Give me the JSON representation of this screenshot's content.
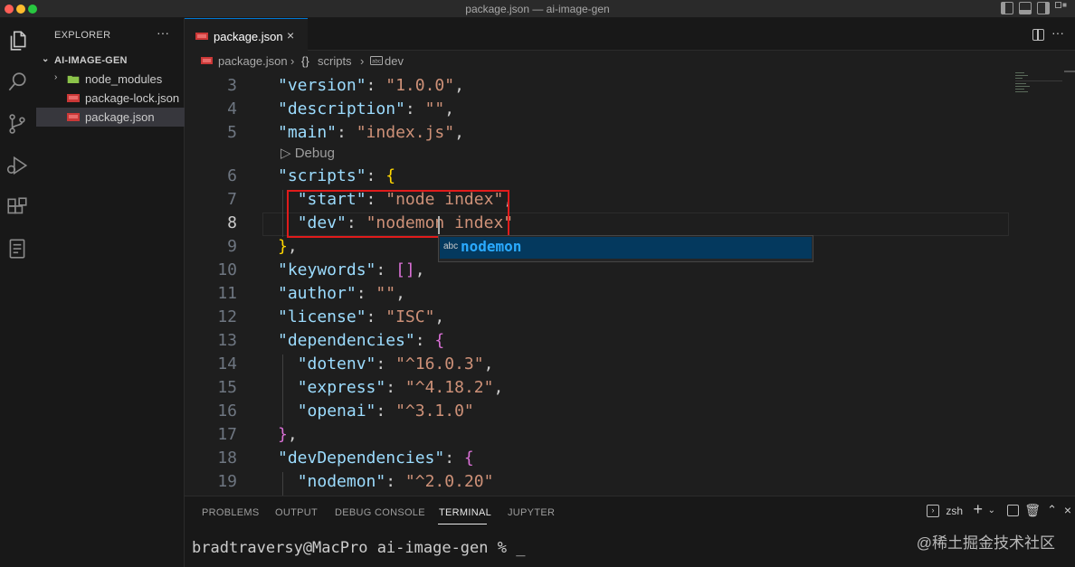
{
  "window": {
    "title": "package.json — ai-image-gen"
  },
  "activity_bar": {
    "icons": [
      "files-icon",
      "search-icon",
      "source-control-icon",
      "run-debug-icon",
      "extensions-icon",
      "notebook-icon"
    ]
  },
  "sidebar": {
    "title": "EXPLORER",
    "more": "···",
    "folder": "AI-IMAGE-GEN",
    "items": [
      {
        "name": "node_modules",
        "type": "folder",
        "selected": false
      },
      {
        "name": "package-lock.json",
        "type": "json",
        "selected": false
      },
      {
        "name": "package.json",
        "type": "json",
        "selected": true
      }
    ]
  },
  "tabs": [
    {
      "label": "package.json",
      "close": "×"
    }
  ],
  "tab_more": "···",
  "breadcrumb": {
    "file": "package.json",
    "section_icon": "{}",
    "section": "scripts",
    "leaf": "dev",
    "sep": "›"
  },
  "editor": {
    "debug_lens": "▷ Debug",
    "active_line": 8,
    "lines": [
      {
        "n": "3",
        "tokens": [
          [
            "k",
            "\"version\""
          ],
          [
            "p",
            ": "
          ],
          [
            "s",
            "\"1.0.0\""
          ],
          [
            "p",
            ","
          ]
        ]
      },
      {
        "n": "4",
        "tokens": [
          [
            "k",
            "\"description\""
          ],
          [
            "p",
            ": "
          ],
          [
            "s",
            "\"\""
          ],
          [
            "p",
            ","
          ]
        ]
      },
      {
        "n": "5",
        "tokens": [
          [
            "k",
            "\"main\""
          ],
          [
            "p",
            ": "
          ],
          [
            "s",
            "\"index.js\""
          ],
          [
            "p",
            ","
          ]
        ]
      },
      {
        "n": "6",
        "tokens": [
          [
            "k",
            "\"scripts\""
          ],
          [
            "p",
            ": "
          ],
          [
            "b2",
            "{"
          ]
        ]
      },
      {
        "n": "7",
        "tokens": [
          [
            "p",
            "  "
          ],
          [
            "k",
            "\"start\""
          ],
          [
            "p",
            ": "
          ],
          [
            "s",
            "\"node index\""
          ],
          [
            "p",
            ","
          ]
        ]
      },
      {
        "n": "8",
        "tokens": [
          [
            "p",
            "  "
          ],
          [
            "k",
            "\"dev\""
          ],
          [
            "p",
            ": "
          ],
          [
            "s",
            "\"nodemon index\""
          ]
        ]
      },
      {
        "n": "9",
        "tokens": [
          [
            "b2",
            "}"
          ],
          [
            "p",
            ","
          ]
        ]
      },
      {
        "n": "10",
        "tokens": [
          [
            "k",
            "\"keywords\""
          ],
          [
            "p",
            ": "
          ],
          [
            "b2",
            "[]"
          ],
          [
            "p",
            ","
          ]
        ]
      },
      {
        "n": "11",
        "tokens": [
          [
            "k",
            "\"author\""
          ],
          [
            "p",
            ": "
          ],
          [
            "s",
            "\"\""
          ],
          [
            "p",
            ","
          ]
        ]
      },
      {
        "n": "12",
        "tokens": [
          [
            "k",
            "\"license\""
          ],
          [
            "p",
            ": "
          ],
          [
            "s",
            "\"ISC\""
          ],
          [
            "p",
            ","
          ]
        ]
      },
      {
        "n": "13",
        "tokens": [
          [
            "k",
            "\"dependencies\""
          ],
          [
            "p",
            ": "
          ],
          [
            "b2",
            "{"
          ]
        ]
      },
      {
        "n": "14",
        "tokens": [
          [
            "p",
            "  "
          ],
          [
            "k",
            "\"dotenv\""
          ],
          [
            "p",
            ": "
          ],
          [
            "s",
            "\"^16.0.3\""
          ],
          [
            "p",
            ","
          ]
        ]
      },
      {
        "n": "15",
        "tokens": [
          [
            "p",
            "  "
          ],
          [
            "k",
            "\"express\""
          ],
          [
            "p",
            ": "
          ],
          [
            "s",
            "\"^4.18.2\""
          ],
          [
            "p",
            ","
          ]
        ]
      },
      {
        "n": "16",
        "tokens": [
          [
            "p",
            "  "
          ],
          [
            "k",
            "\"openai\""
          ],
          [
            "p",
            ": "
          ],
          [
            "s",
            "\"^3.1.0\""
          ]
        ]
      },
      {
        "n": "17",
        "tokens": [
          [
            "b2",
            "}"
          ],
          [
            "p",
            ","
          ]
        ]
      },
      {
        "n": "18",
        "tokens": [
          [
            "k",
            "\"devDependencies\""
          ],
          [
            "p",
            ": "
          ],
          [
            "b2",
            "{"
          ]
        ]
      },
      {
        "n": "19",
        "tokens": [
          [
            "p",
            "  "
          ],
          [
            "k",
            "\"nodemon\""
          ],
          [
            "p",
            ": "
          ],
          [
            "s",
            "\"^2.0.20\""
          ]
        ]
      }
    ],
    "suggestion": {
      "kind": "abc",
      "text": "nodemon"
    }
  },
  "panel": {
    "tabs": [
      "PROBLEMS",
      "OUTPUT",
      "DEBUG CONSOLE",
      "TERMINAL",
      "JUPYTER"
    ],
    "active_tab": "TERMINAL",
    "shell": "zsh",
    "prompt": "bradtraversy@MacPro ai-image-gen % _"
  },
  "watermark": "@稀土掘金技术社区",
  "colors": {
    "key": "#9cdcfe",
    "string": "#ce9178",
    "bracket": "#da70d6",
    "highlight_box": "#e01b1b",
    "suggest_match": "#2aaaff",
    "tab_accent": "#0078d4"
  }
}
